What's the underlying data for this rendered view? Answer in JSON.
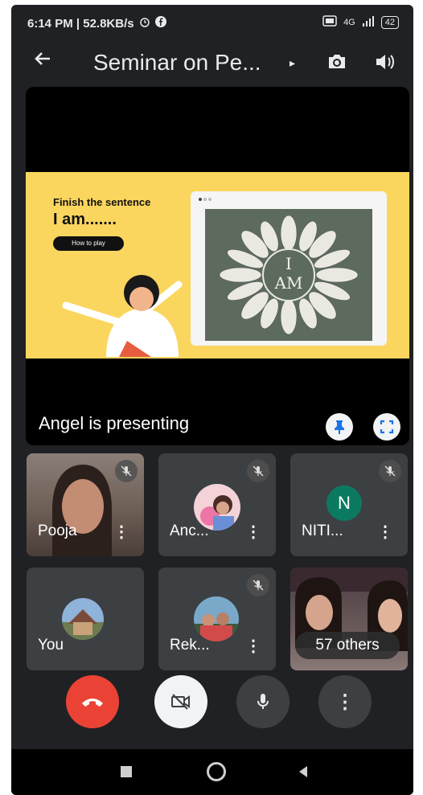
{
  "status_bar": {
    "time_speed": "6:14 PM | 52.8KB/s",
    "network": "4G",
    "battery": "42"
  },
  "app_bar": {
    "title": "Seminar on Pe...",
    "caret": "▸"
  },
  "presentation": {
    "slide": {
      "prompt": "Finish the sentence",
      "heading": "I am.......",
      "play_button": "How to play",
      "center_text_top": "I",
      "center_text_bottom": "AM"
    },
    "presenter_label": "Angel is presenting"
  },
  "participants": [
    {
      "name": "Pooja"
    },
    {
      "name": "Anc..."
    },
    {
      "name": "NITI...",
      "initial": "N"
    },
    {
      "name": "You"
    },
    {
      "name": "Rek..."
    }
  ],
  "others_label": "57 others",
  "colors": {
    "background": "#202124",
    "tile": "#3c4043",
    "end_call": "#ea4335",
    "slide_bg": "#fbd65e",
    "avatar_teal": "#0b7a61"
  }
}
